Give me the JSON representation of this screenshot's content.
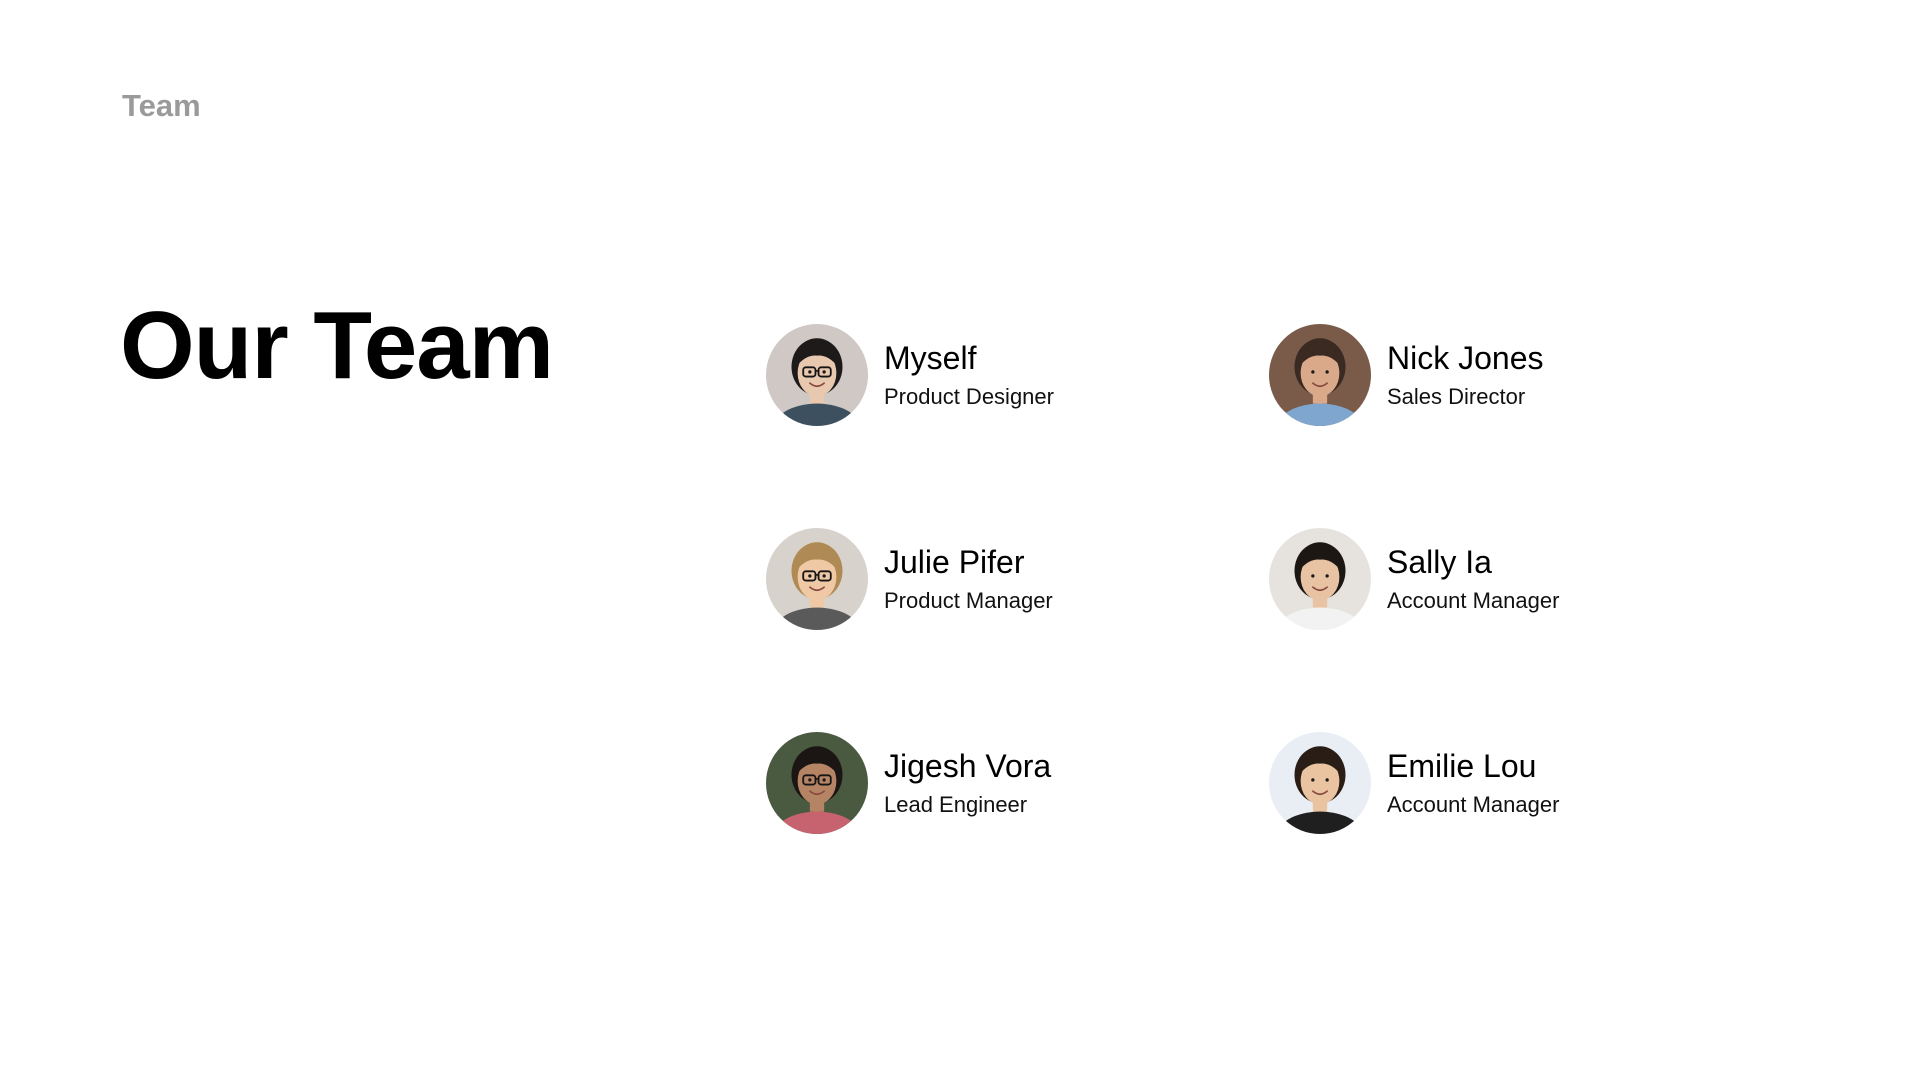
{
  "header": {
    "section_label": "Team"
  },
  "main": {
    "title": "Our Team",
    "members": [
      {
        "name": "Myself",
        "role": "Product Designer",
        "avatar": {
          "bg": "#cfc8c4",
          "skin": "#e8c8ae",
          "hair": "#1e1a1a",
          "shirt": "#3d5060",
          "glasses": true
        }
      },
      {
        "name": "Nick Jones",
        "role": "Sales Director",
        "avatar": {
          "bg": "#7a5a48",
          "skin": "#d9a98a",
          "hair": "#3a2a22",
          "shirt": "#7ea6cf",
          "glasses": false
        }
      },
      {
        "name": "Julie Pifer",
        "role": "Product Manager",
        "avatar": {
          "bg": "#d8d2cc",
          "skin": "#efc9a6",
          "hair": "#b08a55",
          "shirt": "#5a5a5a",
          "glasses": true
        }
      },
      {
        "name": "Sally Ia",
        "role": "Account Manager",
        "avatar": {
          "bg": "#e6e3df",
          "skin": "#e7c3a3",
          "hair": "#1d1714",
          "shirt": "#f2f2f2",
          "glasses": false
        }
      },
      {
        "name": "Jigesh Vora",
        "role": "Lead Engineer",
        "avatar": {
          "bg": "#4a5a40",
          "skin": "#b58465",
          "hair": "#1b1614",
          "shirt": "#c7636f",
          "glasses": true
        }
      },
      {
        "name": "Emilie Lou",
        "role": "Account Manager",
        "avatar": {
          "bg": "#e9eef5",
          "skin": "#eac3a0",
          "hair": "#2a1d15",
          "shirt": "#1f1f1f",
          "glasses": false
        }
      }
    ]
  }
}
